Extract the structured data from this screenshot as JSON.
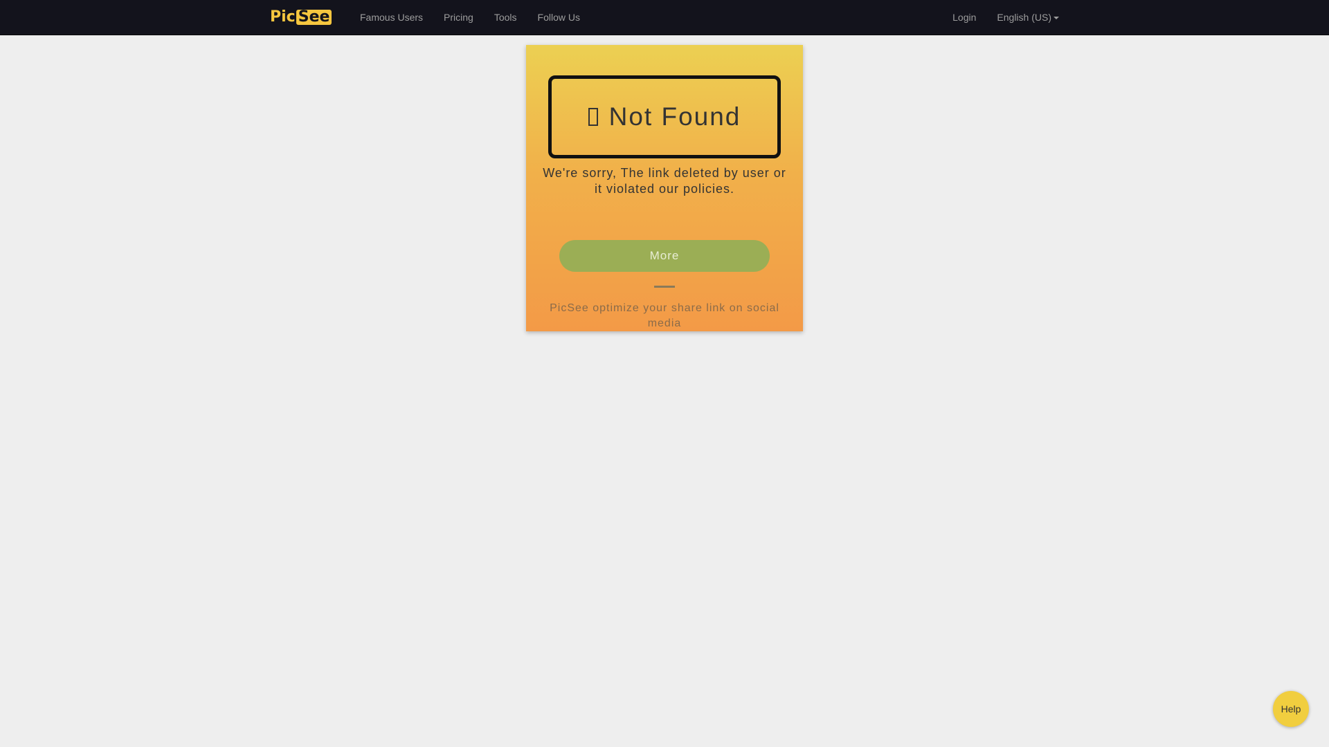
{
  "navbar": {
    "logo": {
      "prefix": "Pic",
      "boxed": "See"
    },
    "links": [
      "Famous Users",
      "Pricing",
      "Tools",
      "Follow Us"
    ],
    "login": "Login",
    "language": "English (US)"
  },
  "card": {
    "heading": "Not Found",
    "message": "We're sorry, The link deleted by user or it violated our policies.",
    "button": "More",
    "tagline": "PicSee optimize your share link on social media"
  },
  "help": {
    "label": "Help"
  },
  "colors": {
    "navbar_bg": "#13131c",
    "brand_yellow": "#f5c63f",
    "card_top": "#ecd052",
    "card_bottom": "#f39a47",
    "button_green": "#9bae55",
    "page_bg": "#eeeeee"
  },
  "icons": {
    "heading_icon": "missing-glyph-icon",
    "language_caret": "caret-down-icon"
  }
}
